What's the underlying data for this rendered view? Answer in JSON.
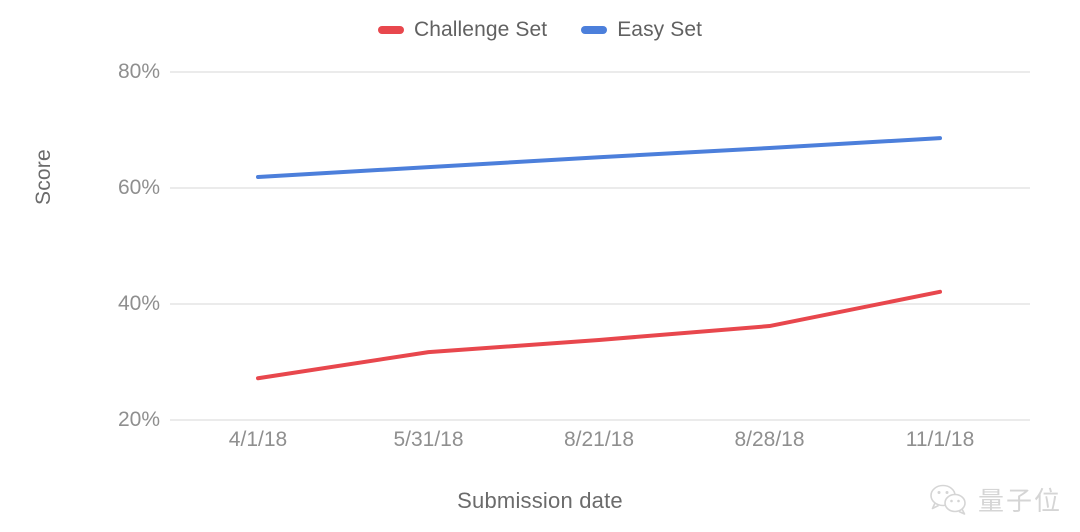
{
  "chart_data": {
    "type": "line",
    "title": "",
    "xlabel": "Submission date",
    "ylabel": "Score",
    "categories": [
      "4/1/18",
      "5/31/18",
      "8/21/18",
      "8/28/18",
      "11/1/18"
    ],
    "ylim": [
      20,
      80
    ],
    "yticks": [
      "20%",
      "40%",
      "60%",
      "80%"
    ],
    "ytick_values": [
      20,
      40,
      60,
      80
    ],
    "y_unit": "%",
    "grid": true,
    "legend_position": "top-center",
    "series": [
      {
        "name": "Challenge Set",
        "color": "#e8474d",
        "values": [
          27.2,
          31.7,
          33.8,
          36.2,
          42.1
        ]
      },
      {
        "name": "Easy Set",
        "color": "#4c7fdb",
        "values": [
          61.9,
          63.6,
          65.3,
          66.9,
          68.6
        ]
      }
    ]
  },
  "legend": {
    "items": [
      {
        "label": "Challenge Set",
        "swatch": "legend-swatch-challenge-set"
      },
      {
        "label": "Easy Set",
        "swatch": "legend-swatch-easy-set"
      }
    ]
  },
  "axes": {
    "y_title": "Score",
    "x_title": "Submission date"
  },
  "watermark": {
    "text": "量子位",
    "icon": "wechat-icon"
  },
  "colors": {
    "challenge_set": "#e8474d",
    "easy_set": "#4c7fdb",
    "gridline": "#ebebeb",
    "tick_text": "#8f8f8f",
    "axis_title": "#6b6b6b",
    "legend_text": "#616161",
    "background": "#ffffff"
  }
}
